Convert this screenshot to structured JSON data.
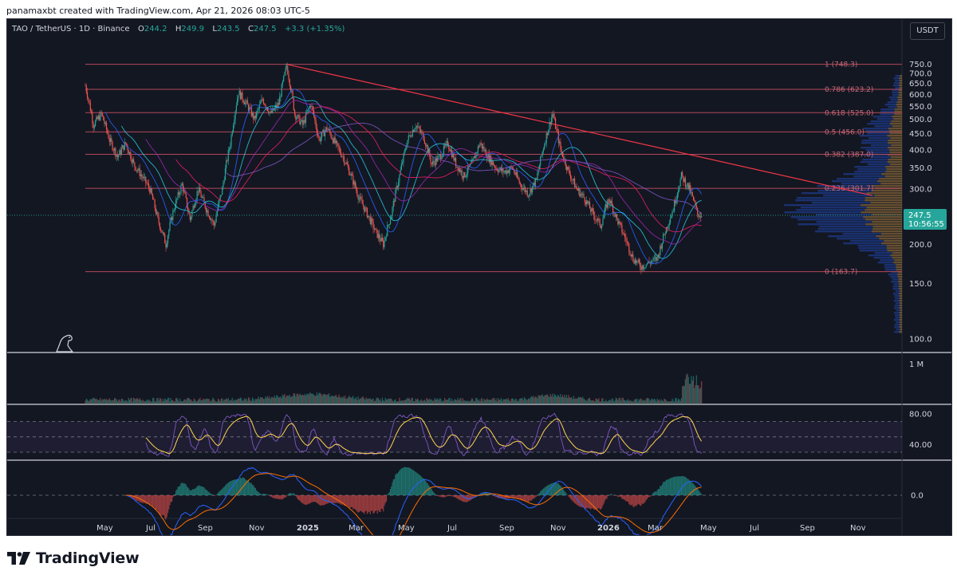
{
  "caption": "panamaxbt created with TradingView.com, Apr 21, 2026 08:03 UTC-5",
  "brand": "TradingView",
  "legend": {
    "symbol": "TAO / TetherUS · 1D · Binance",
    "o_label": "O",
    "o": "244.2",
    "h_label": "H",
    "h": "249.9",
    "l_label": "L",
    "l": "243.5",
    "c_label": "C",
    "c": "247.5",
    "change": "+3.3 (+1.35%)"
  },
  "currency": "USDT",
  "price_tag": {
    "price": "247.5",
    "countdown": "10:56:55"
  },
  "colors": {
    "background": "#131722",
    "up": "#26a69a",
    "down": "#ef5350",
    "fib": "#b2485a",
    "trendline": "#f23645",
    "rsi": "#7e57c2",
    "rsi_ma": "#ffd54f",
    "macd": "#2962ff",
    "signal": "#ff6d00",
    "text": "#b2b5be"
  },
  "chart_data": {
    "type": "candlestick",
    "title": "TAO / TetherUS · 1D · Binance",
    "x_ticks": [
      "May",
      "Jul",
      "Sep",
      "Nov",
      "2025",
      "Mar",
      "May",
      "Jul",
      "Sep",
      "Nov",
      "2026",
      "Mar",
      "May",
      "Jul",
      "Sep",
      "Nov"
    ],
    "y_ticks": [
      "750.0",
      "700.0",
      "650.0",
      "600.0",
      "550.0",
      "500.0",
      "450.0",
      "400.0",
      "350.0",
      "300.0",
      "200.0",
      "150.0",
      "100.0"
    ],
    "ylim": [
      90,
      800
    ],
    "price_path": [
      [
        0,
        640
      ],
      [
        2,
        480
      ],
      [
        4,
        520
      ],
      [
        6,
        430
      ],
      [
        8,
        380
      ],
      [
        10,
        420
      ],
      [
        12,
        360
      ],
      [
        14,
        330
      ],
      [
        16,
        300
      ],
      [
        18,
        240
      ],
      [
        20,
        200
      ],
      [
        22,
        260
      ],
      [
        24,
        310
      ],
      [
        26,
        240
      ],
      [
        28,
        300
      ],
      [
        30,
        260
      ],
      [
        32,
        230
      ],
      [
        34,
        300
      ],
      [
        36,
        420
      ],
      [
        38,
        610
      ],
      [
        40,
        560
      ],
      [
        42,
        500
      ],
      [
        44,
        580
      ],
      [
        46,
        520
      ],
      [
        48,
        560
      ],
      [
        50,
        740
      ],
      [
        52,
        520
      ],
      [
        54,
        480
      ],
      [
        56,
        560
      ],
      [
        58,
        430
      ],
      [
        60,
        470
      ],
      [
        62,
        420
      ],
      [
        64,
        380
      ],
      [
        66,
        330
      ],
      [
        68,
        280
      ],
      [
        70,
        250
      ],
      [
        72,
        220
      ],
      [
        74,
        200
      ],
      [
        76,
        250
      ],
      [
        78,
        330
      ],
      [
        80,
        430
      ],
      [
        82,
        480
      ],
      [
        84,
        440
      ],
      [
        86,
        360
      ],
      [
        88,
        380
      ],
      [
        90,
        420
      ],
      [
        92,
        360
      ],
      [
        94,
        330
      ],
      [
        96,
        360
      ],
      [
        98,
        420
      ],
      [
        100,
        380
      ],
      [
        102,
        350
      ],
      [
        104,
        340
      ],
      [
        106,
        350
      ],
      [
        108,
        310
      ],
      [
        110,
        290
      ],
      [
        112,
        320
      ],
      [
        114,
        420
      ],
      [
        116,
        520
      ],
      [
        118,
        400
      ],
      [
        120,
        340
      ],
      [
        122,
        300
      ],
      [
        124,
        280
      ],
      [
        126,
        250
      ],
      [
        128,
        230
      ],
      [
        130,
        280
      ],
      [
        132,
        240
      ],
      [
        134,
        210
      ],
      [
        136,
        180
      ],
      [
        138,
        170
      ],
      [
        140,
        175
      ],
      [
        142,
        180
      ],
      [
        144,
        220
      ],
      [
        146,
        260
      ],
      [
        148,
        330
      ],
      [
        150,
        300
      ],
      [
        152,
        250
      ],
      [
        153,
        247.5
      ]
    ],
    "fib_levels": [
      {
        "label": "1 (748.3)",
        "value": 748.3
      },
      {
        "label": "0.786 (623.2)",
        "value": 623.2
      },
      {
        "label": "0.618 (525.0)",
        "value": 525.0
      },
      {
        "label": "0.5 (456.0)",
        "value": 456.0
      },
      {
        "label": "0.382 (387.0)",
        "value": 387.0
      },
      {
        "label": "0.236 (301.7)",
        "value": 301.7
      },
      {
        "label": "0 (163.7)",
        "value": 163.7
      }
    ],
    "volume_axis_label": "1 M",
    "rsi": {
      "ticks": [
        "80.00",
        "40.00"
      ],
      "overbought": 70,
      "oversold": 30
    },
    "macd": {
      "ticks": [
        "0.0"
      ]
    }
  }
}
